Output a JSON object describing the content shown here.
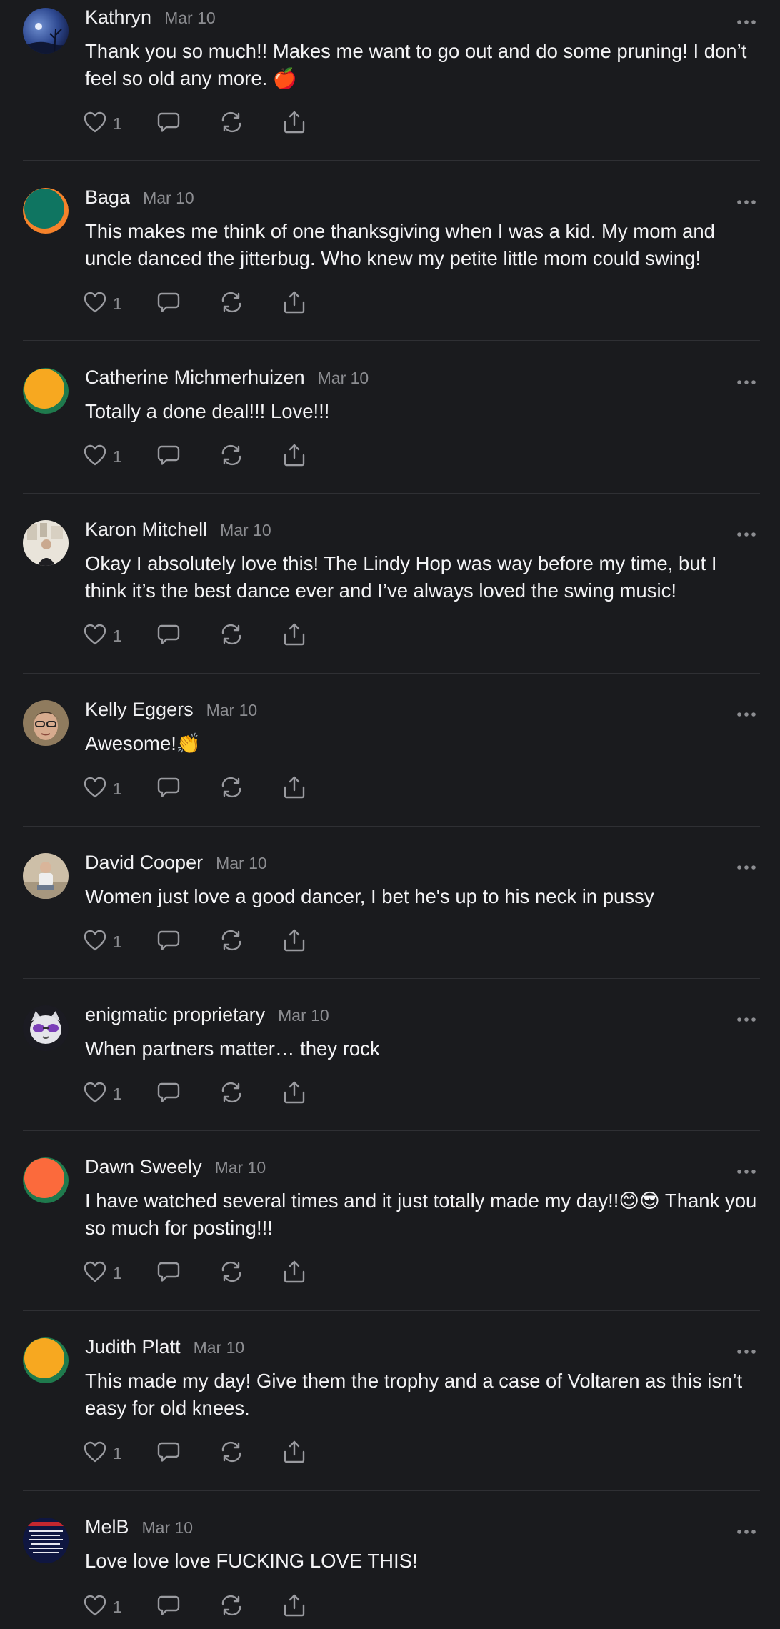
{
  "comments": [
    {
      "name": "Kathryn",
      "date": "Mar 10",
      "text": "Thank you so much!! Makes me want to go out and do some pruning! I don’t feel so old any more. 🍎",
      "likes": "1",
      "avatar": "photo-night-sky"
    },
    {
      "name": "Baga",
      "date": "Mar 10",
      "text": "This makes me think of one thanksgiving when I was a kid. My mom and uncle danced the jitterbug. Who knew my petite little mom could swing!",
      "likes": "1",
      "avatar": "default-teal",
      "avatar_color": "#0f7561"
    },
    {
      "name": "Catherine Michmerhuizen",
      "date": "Mar 10",
      "text": "Totally a done deal!!! Love!!!",
      "likes": "1",
      "avatar": "default-yellow",
      "avatar_color": "#f7a820"
    },
    {
      "name": "Karon Mitchell",
      "date": "Mar 10",
      "text": "Okay I absolutely love this! The Lindy Hop was way before my time, but I think it’s the best dance ever and I’ve always loved the swing music!",
      "likes": "1",
      "avatar": "photo-person-in-room"
    },
    {
      "name": "Kelly Eggers",
      "date": "Mar 10",
      "text": "Awesome!👏",
      "likes": "1",
      "avatar": "photo-face"
    },
    {
      "name": "David Cooper",
      "date": "Mar 10",
      "text": "Women just love a good dancer, I bet he's up to his neck in pussy",
      "likes": "1",
      "avatar": "photo-person-sitting"
    },
    {
      "name": "enigmatic proprietary",
      "date": "Mar 10",
      "text": "When partners matter… they rock",
      "likes": "1",
      "avatar": "photo-cat-sunglasses"
    },
    {
      "name": "Dawn Sweely",
      "date": "Mar 10",
      "text": "I have watched several times and it just totally made my day!!😊😎 Thank you so much for posting!!!",
      "likes": "1",
      "avatar": "default-orange",
      "avatar_color": "#fb6a3c"
    },
    {
      "name": "Judith Platt",
      "date": "Mar 10",
      "text": "This made my day! Give them the trophy and a case of Voltaren as this isn’t easy for old knees.",
      "likes": "1",
      "avatar": "default-yellow",
      "avatar_color": "#f7a820"
    },
    {
      "name": "MelB",
      "date": "Mar 10",
      "text": "Love love love FUCKING LOVE THIS!",
      "likes": "1",
      "avatar": "photo-text-poster"
    }
  ],
  "colors": {
    "background": "#1a1b1e",
    "text": "#f3f3f5",
    "secondary": "#8c8d91",
    "divider": "#2f3034",
    "avatar_ring_green": "#1f7a4d",
    "avatar_ring_orange": "#f6822a"
  },
  "icons": [
    "heart-icon",
    "comment-icon",
    "restack-icon",
    "share-icon",
    "more-icon"
  ]
}
